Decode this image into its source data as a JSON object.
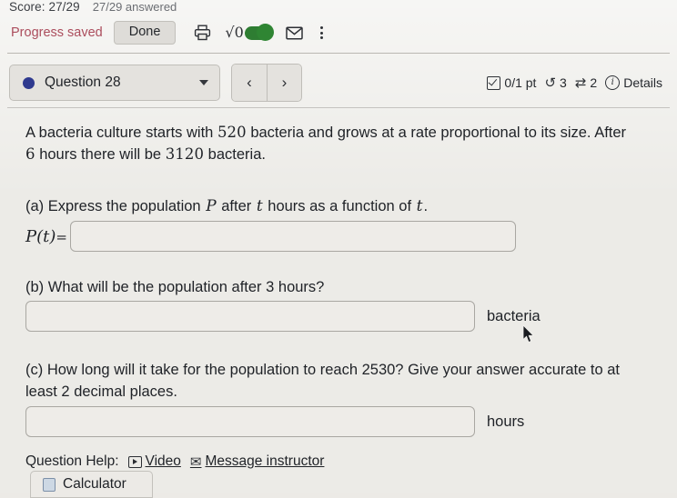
{
  "statusbar": {
    "score": "Score: 27/29",
    "answered": "27/29 answered"
  },
  "toolbar": {
    "progress_saved": "Progress saved",
    "done_label": "Done",
    "print_icon": "printer-icon",
    "sqrt_label": "√0",
    "toggle_state": "on",
    "toggle_color": "#2e7d32",
    "mail_icon": "✉",
    "menu_icon": "kebab-menu-icon"
  },
  "question_header": {
    "dot_color": "#2f3a8f",
    "question_label": "Question 28",
    "prev_label": "‹",
    "next_label": "›",
    "points": "0/1 pt",
    "attempts_icon": "↺",
    "attempts": "3",
    "retry_icon": "⇄",
    "retries": "2",
    "details_label": "Details"
  },
  "problem": {
    "text_1": "A bacteria culture starts with ",
    "num_start": "520",
    "text_2": " bacteria and grows at a rate proportional to its size. After ",
    "num_hours": "6",
    "text_3": " hours there will be ",
    "num_end": "3120",
    "text_4": " bacteria."
  },
  "parts": {
    "a": {
      "prompt_1": "(a) Express the population ",
      "var_p": "P",
      "prompt_2": " after ",
      "var_t": "t",
      "prompt_3": " hours as a function of ",
      "var_t2": "t",
      "prompt_4": ".",
      "input_label": "P(t)=",
      "input_value": "",
      "placeholder": ""
    },
    "b": {
      "prompt": "(b) What will be the population after 3 hours?",
      "input_value": "",
      "placeholder": "",
      "unit": "bacteria"
    },
    "c": {
      "prompt": "(c) How long will it take for the population to reach 2530? Give your answer accurate to at least 2 decimal places.",
      "input_value": "",
      "placeholder": "",
      "unit": "hours"
    }
  },
  "question_help": {
    "label": "Question Help:",
    "video_label": "Video",
    "message_label": "Message instructor"
  },
  "calculator": {
    "label": "Calculator"
  }
}
